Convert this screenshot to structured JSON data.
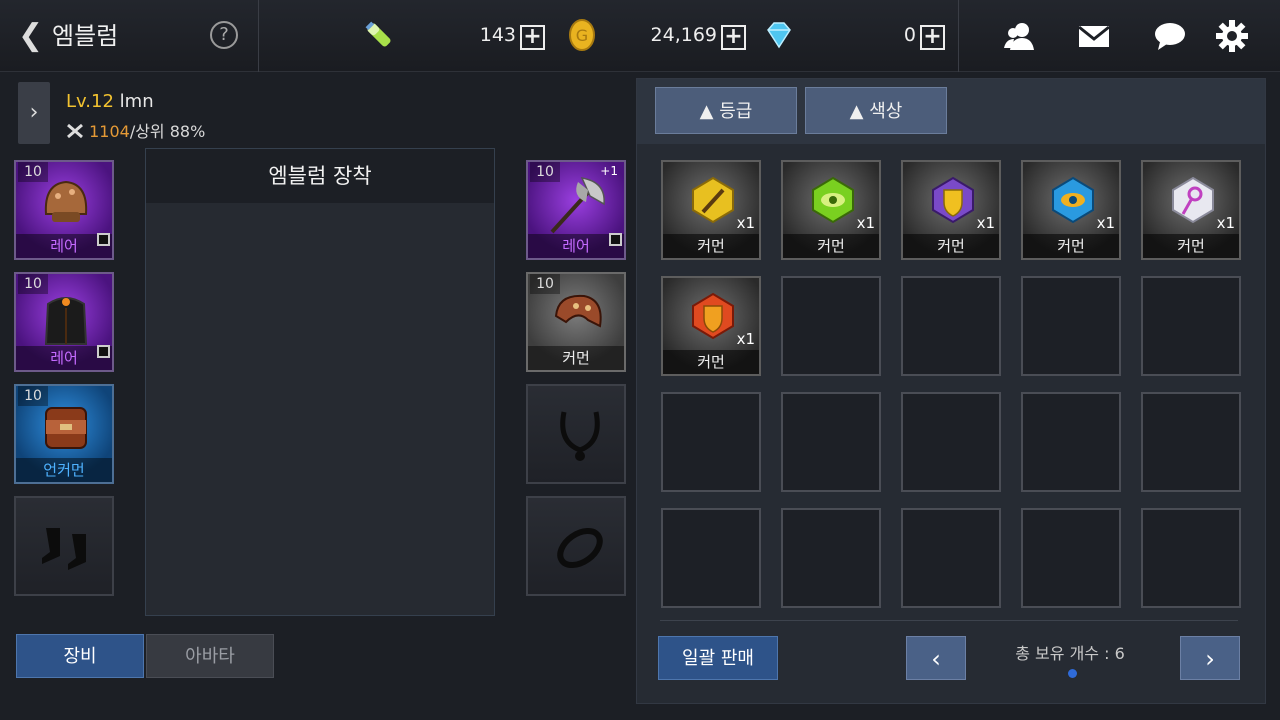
{
  "header": {
    "back_icon": "chevron-left-icon",
    "title": "엠블럼",
    "help_label": "?",
    "resources": [
      {
        "icon": "energy-potion-icon",
        "value": "143"
      },
      {
        "icon": "gold-coin-icon",
        "value": "24,169"
      },
      {
        "icon": "diamond-icon",
        "value": "0"
      }
    ],
    "plus_label": "+",
    "icons": [
      "friends-icon",
      "mail-icon",
      "chat-icon",
      "gear-icon"
    ]
  },
  "profile": {
    "level": "Lv.12",
    "name": "lmn",
    "power": "1104",
    "rank": "/상위 88%"
  },
  "equipment_left": [
    {
      "level": "10",
      "grade": "레어",
      "rarity": "rare",
      "icon": "helmet-icon"
    },
    {
      "level": "10",
      "grade": "레어",
      "rarity": "rare",
      "icon": "armor-icon"
    },
    {
      "level": "10",
      "grade": "언커먼",
      "rarity": "uncommon",
      "icon": "bracer-icon"
    },
    {
      "level": "",
      "grade": "",
      "rarity": "empty",
      "icon": "boots-icon"
    }
  ],
  "equipment_right": [
    {
      "level": "10",
      "grade": "레어",
      "rarity": "rare",
      "icon": "axe-icon",
      "enhance": "+1"
    },
    {
      "level": "10",
      "grade": "커먼",
      "rarity": "common",
      "icon": "pauldron-icon"
    },
    {
      "level": "",
      "grade": "",
      "rarity": "empty",
      "icon": "necklace-icon"
    },
    {
      "level": "",
      "grade": "",
      "rarity": "empty",
      "icon": "ring-icon"
    }
  ],
  "emblem_panel": {
    "title": "엠블럼 장착"
  },
  "tabs": {
    "equip": "장비",
    "avatar": "아바타"
  },
  "sort": {
    "grade": "▲ 등급",
    "color": "▲ 색상"
  },
  "inventory": [
    {
      "icon": "sword-emblem-icon",
      "grade": "커먼",
      "count": "x1"
    },
    {
      "icon": "eye-emblem-green-icon",
      "grade": "커먼",
      "count": "x1"
    },
    {
      "icon": "shield-emblem-purple-icon",
      "grade": "커먼",
      "count": "x1"
    },
    {
      "icon": "eye-emblem-blue-icon",
      "grade": "커먼",
      "count": "x1"
    },
    {
      "icon": "staff-emblem-white-icon",
      "grade": "커먼",
      "count": "x1"
    },
    {
      "icon": "shield-emblem-red-icon",
      "grade": "커먼",
      "count": "x1"
    }
  ],
  "footer": {
    "sell_all": "일괄 판매",
    "prev": "‹",
    "next": "›",
    "total": "총 보유 개수 : 6"
  }
}
